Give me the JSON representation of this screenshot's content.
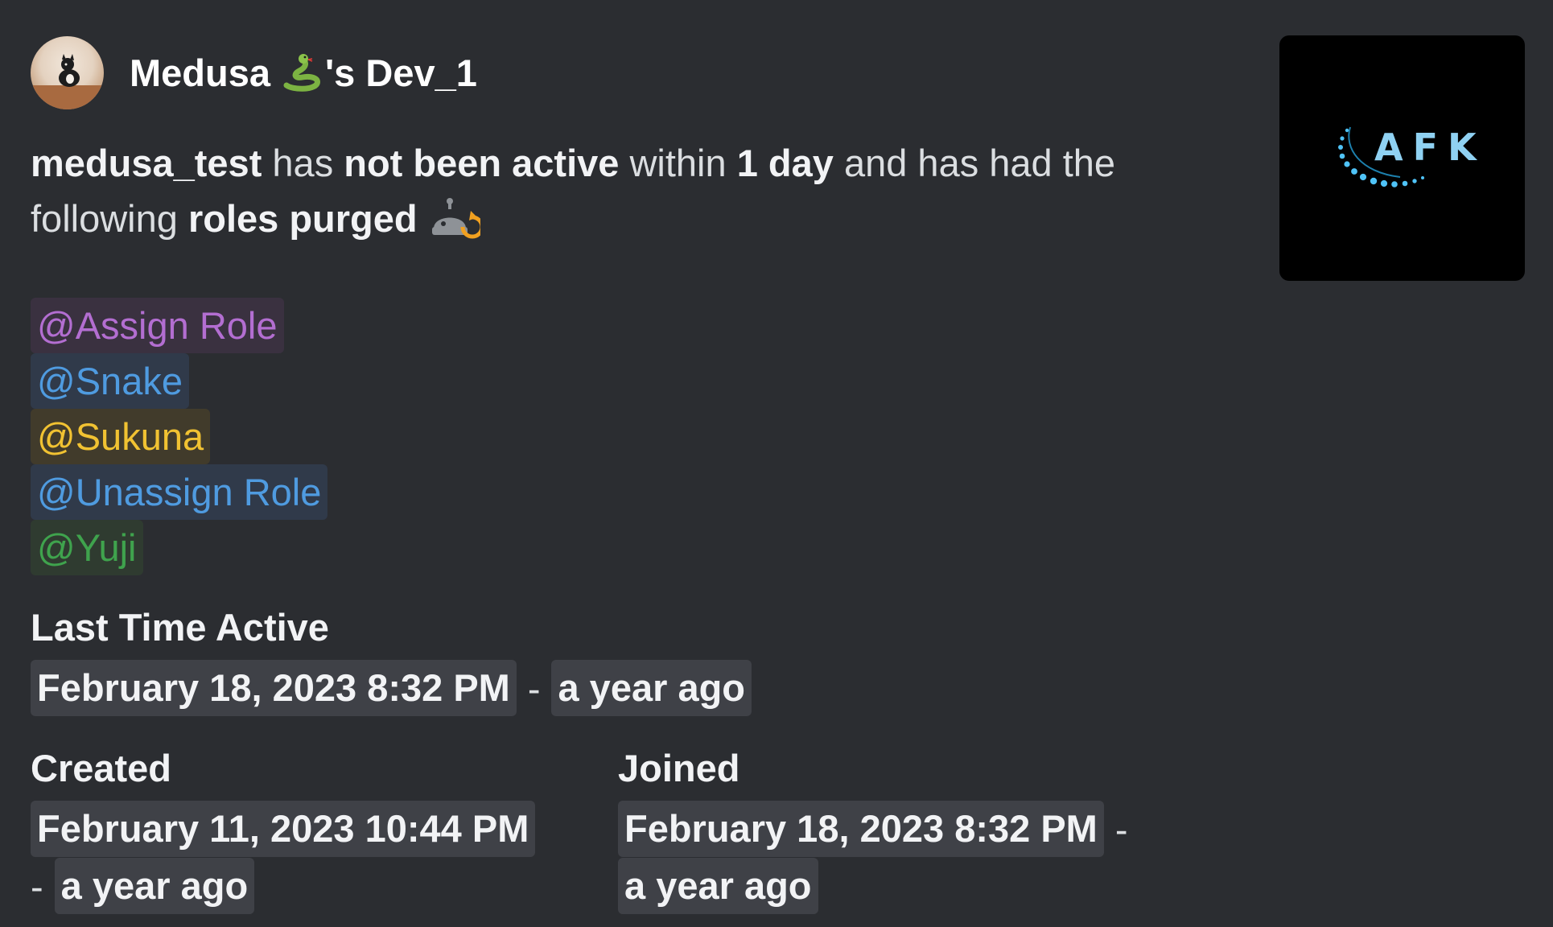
{
  "author": {
    "name_prefix": "Medusa",
    "name_suffix": "'s Dev_1",
    "avatar": "avatar-icon",
    "name_icon": "snake-icon"
  },
  "thumbnail": {
    "text": "AFK"
  },
  "description": {
    "user": "medusa_test",
    "t1": " has ",
    "status": "not been active",
    "t2": " within ",
    "duration": "1 day",
    "t3": " and has had the following ",
    "action": "roles purged",
    "action_icon": "purge-icon"
  },
  "roles": [
    {
      "label": "@Assign Role",
      "color": "#b36ed1",
      "bg": "#3a3140"
    },
    {
      "label": "@Snake",
      "color": "#4f9be0",
      "bg": "#303a4a"
    },
    {
      "label": "@Sukuna",
      "color": "#f1c232",
      "bg": "#413b2b"
    },
    {
      "label": "@Unassign Role",
      "color": "#4f9be0",
      "bg": "#303a4a"
    },
    {
      "label": "@Yuji",
      "color": "#3fa34d",
      "bg": "#2f3b30"
    }
  ],
  "fields": {
    "last_active": {
      "name": "Last Time Active",
      "timestamp": "February 18, 2023 8:32 PM",
      "separator": "-",
      "relative": "a year ago"
    },
    "created": {
      "name": "Created",
      "timestamp": "February 11, 2023 10:44 PM",
      "separator": "-",
      "relative": "a year ago"
    },
    "joined": {
      "name": "Joined",
      "timestamp": "February 18, 2023 8:32 PM",
      "separator": "-",
      "relative": "a year ago"
    }
  },
  "colors": {
    "background": "#2b2d31",
    "timestamp_bg": "#3f4147",
    "text": "#dbdee1",
    "heading": "#f2f3f5"
  }
}
